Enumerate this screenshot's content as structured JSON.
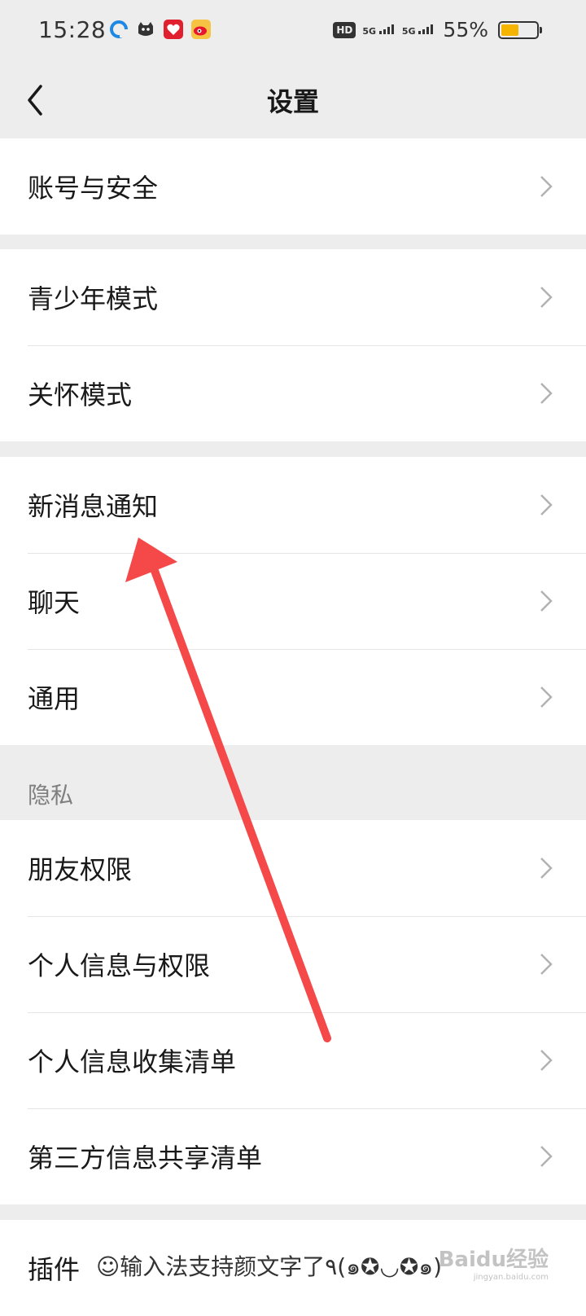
{
  "status_bar": {
    "time": "15:28",
    "hd_label": "HD",
    "signal1": "5G",
    "signal2": "5G",
    "battery_percent_text": "55%",
    "battery_level": 0.55,
    "notification_icons": [
      "browser-icon",
      "cat-app-icon",
      "heart-app-icon",
      "weibo-icon"
    ]
  },
  "nav": {
    "title": "设置",
    "back_icon": "chevron-left-icon"
  },
  "groups": {
    "account": {
      "items": [
        {
          "label": "账号与安全"
        }
      ]
    },
    "modes": {
      "items": [
        {
          "label": "青少年模式"
        },
        {
          "label": "关怀模式"
        }
      ]
    },
    "general": {
      "items": [
        {
          "label": "新消息通知"
        },
        {
          "label": "聊天"
        },
        {
          "label": "通用"
        }
      ]
    },
    "privacy": {
      "header": "隐私",
      "items": [
        {
          "label": "朋友权限"
        },
        {
          "label": "个人信息与权限"
        },
        {
          "label": "个人信息收集清单"
        },
        {
          "label": "第三方信息共享清单"
        }
      ]
    },
    "plugins": {
      "items": [
        {
          "label": "插件",
          "hint": "☺输入法支持颜文字了٩(๑✪◡✪๑)"
        }
      ]
    }
  },
  "annotation": {
    "arrow_color": "#f54848",
    "points_to": "新消息通知"
  },
  "watermark": {
    "text": "Baidu经验",
    "sub": "jingyan.baidu.com"
  },
  "colors": {
    "background": "#ededed",
    "row": "#ffffff",
    "accent_battery": "#f4b400"
  }
}
